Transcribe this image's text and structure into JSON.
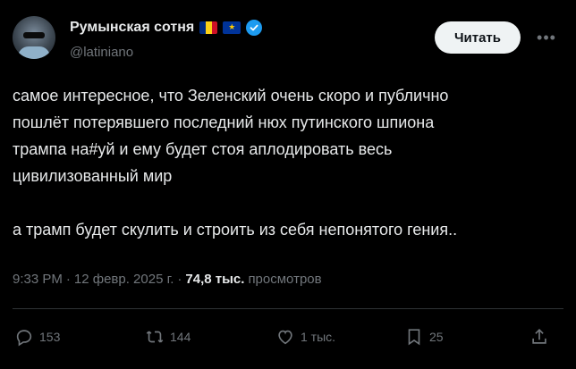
{
  "author": {
    "display_name": "Румынская сотня",
    "handle": "@latiniano",
    "flags": [
      "romania-flag",
      "eu-flag"
    ],
    "verified_icon": "verified-badge-icon",
    "verified_color": "#1d9bf0"
  },
  "follow_button": {
    "label": "Читать"
  },
  "more_button": {
    "icon": "more-icon"
  },
  "tweet": {
    "text": "самое интересное, что Зеленский очень скоро и публично\nпошлёт потерявшего последний нюх путинского шпиона\nтрампа на#уй и ему будет стоя аплодировать весь\nцивилизованный мир\n\nа трамп будет скулить и строить из себя непонятого гения.."
  },
  "meta": {
    "time": "9:33 PM",
    "dot": "·",
    "date": "12 февр. 2025 г.",
    "dot2": "·",
    "views_count": "74,8 тыс.",
    "views_label": "просмотров"
  },
  "actions": {
    "replies": {
      "icon": "reply-icon",
      "count": "153"
    },
    "reposts": {
      "icon": "repost-icon",
      "count": "144"
    },
    "likes": {
      "icon": "like-icon",
      "count": "1 тыс."
    },
    "bookmarks": {
      "icon": "bookmark-icon",
      "count": "25"
    },
    "share": {
      "icon": "share-icon"
    }
  },
  "colors": {
    "background": "#000000",
    "text": "#e7e9ea",
    "muted": "#71767b",
    "divider": "#2f3336",
    "button_bg": "#eff3f4"
  }
}
